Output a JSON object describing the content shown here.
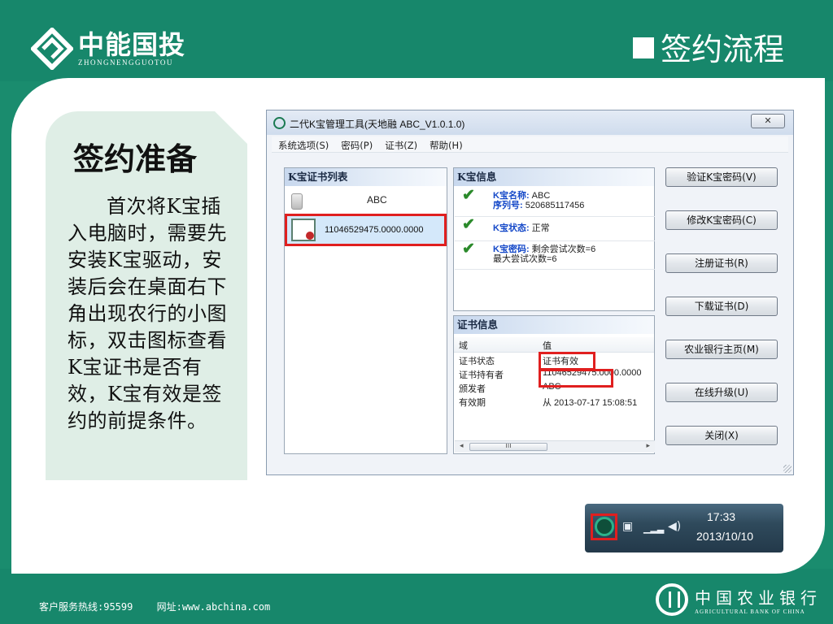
{
  "brand": {
    "name_cn": "中能国投",
    "name_en": "ZHONGNENGGUOTOU"
  },
  "slide_title": "签约流程",
  "note": {
    "title": "签约准备",
    "body": "首次将K宝插入电脑时，需要先安装K宝驱动，安装后会在桌面右下角出现农行的小图标，双击图标查看K宝证书是否有效，K宝有效是签约的前提条件。"
  },
  "window": {
    "title": "二代K宝管理工具(天地融 ABC_V1.0.1.0)",
    "close_label": "✕",
    "menu": [
      "系统选项(S)",
      "密码(P)",
      "证书(Z)",
      "帮助(H)"
    ],
    "cert_list": {
      "header": "K宝证书列表",
      "items": [
        "ABC",
        "11046529475.0000.0000"
      ]
    },
    "k_info": {
      "header": "K宝信息",
      "name_label": "K宝名称:",
      "name_value": "ABC",
      "serial_label": "序列号:",
      "serial_value": "520685117456",
      "status_label": "K宝状态:",
      "status_value": "正常",
      "pwd_label": "K宝密码:",
      "pwd_value": "剩余尝试次数=6",
      "pwd_max": "最大尝试次数=6"
    },
    "cert_info": {
      "header": "证书信息",
      "col_field": "域",
      "col_value": "值",
      "rows": [
        {
          "k": "证书状态",
          "v": "证书有效"
        },
        {
          "k": "证书持有者",
          "v": "11046529475.0000.0000"
        },
        {
          "k": "颁发者",
          "v": "ABC"
        },
        {
          "k": "有效期",
          "v": "从 2013-07-17 15:08:51"
        }
      ],
      "scroll_left": "◂",
      "scroll_thumb": "ııı",
      "scroll_right": "▸"
    },
    "buttons": [
      "验证K宝密码(V)",
      "修改K宝密码(C)",
      "注册证书(R)",
      "下载证书(D)",
      "农业银行主页(M)",
      "在线升级(U)",
      "关闭(X)"
    ]
  },
  "tray": {
    "time": "17:33",
    "date": "2013/10/10"
  },
  "footer": {
    "hotline": "客户服务热线:95599",
    "website": "网址:www.abchina.com"
  },
  "bank": {
    "name_cn": "中国农业银行",
    "name_en": "AGRICULTURAL BANK OF CHINA"
  },
  "colors": {
    "brand_green": "#17876b",
    "highlight_red": "#e01f1f",
    "note_bg": "#dfeee6"
  }
}
